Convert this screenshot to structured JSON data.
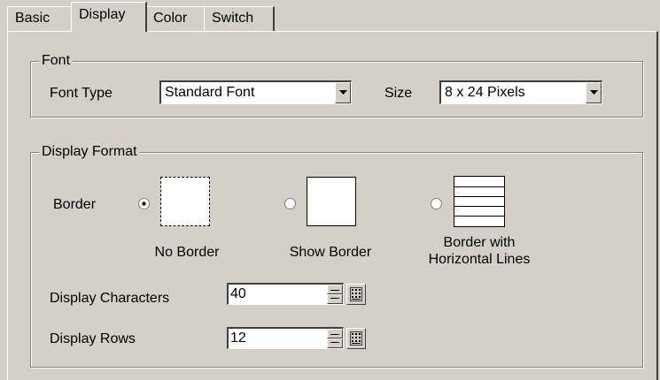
{
  "tabs": [
    {
      "label": "Basic",
      "active": false
    },
    {
      "label": "Display",
      "active": true
    },
    {
      "label": "Color",
      "active": false
    },
    {
      "label": "Switch",
      "active": false
    }
  ],
  "font_group": {
    "legend": "Font",
    "font_type_label": "Font Type",
    "font_type_value": "Standard Font",
    "size_label": "Size",
    "size_value": "8 x 24 Pixels"
  },
  "display_format_group": {
    "legend": "Display Format",
    "border_label": "Border",
    "border_options": [
      {
        "label": "No Border",
        "selected": true
      },
      {
        "label": "Show Border",
        "selected": false
      },
      {
        "label": "Border with\nHorizontal Lines",
        "selected": false
      }
    ],
    "display_characters_label": "Display Characters",
    "display_characters_value": "40",
    "display_rows_label": "Display Rows",
    "display_rows_value": "12"
  },
  "icons": {
    "dropdown": "chevron-down-icon",
    "spin_up": "spin-up-icon",
    "spin_down": "spin-down-icon",
    "keypad": "keypad-icon"
  },
  "colors": {
    "window_bg": "#d4d0c8",
    "field_bg": "#ffffff",
    "shadow": "#808080",
    "dark_shadow": "#404040",
    "highlight": "#ffffff"
  }
}
